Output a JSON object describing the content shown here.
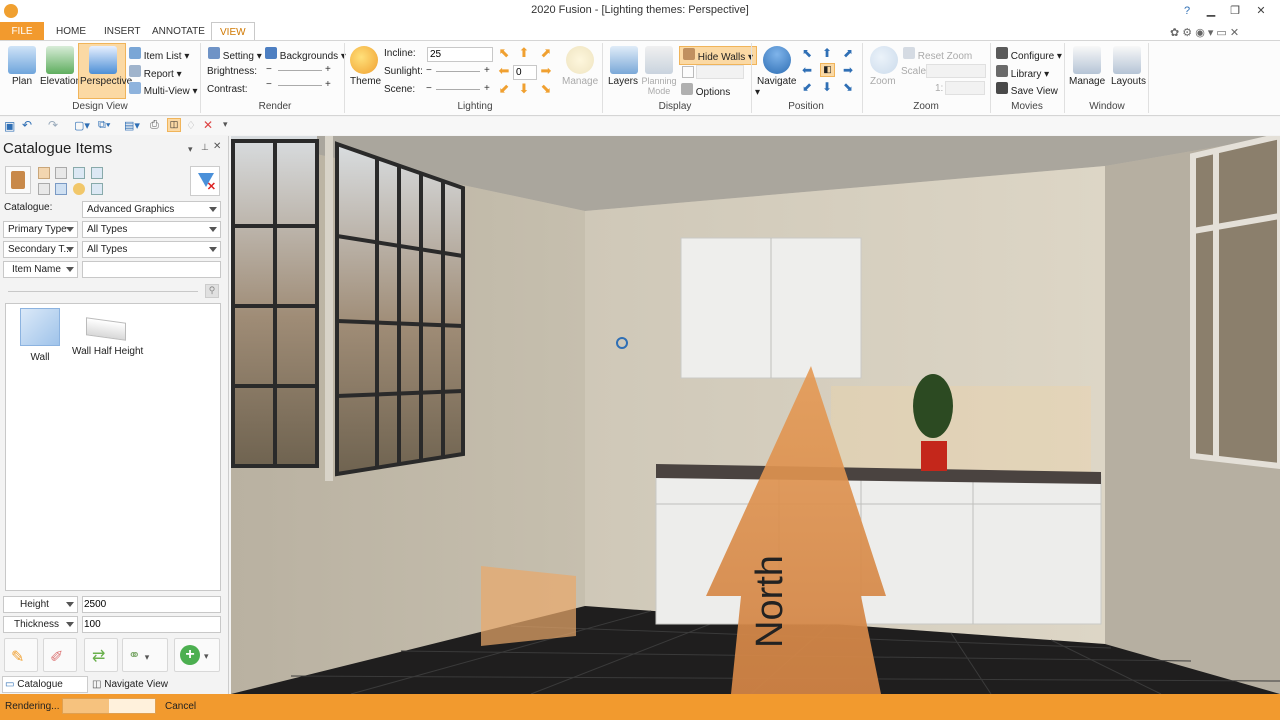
{
  "window": {
    "title": "2020 Fusion - [Lighting themes: Perspective]"
  },
  "tabs": [
    "FILE",
    "HOME",
    "INSERT",
    "ANNOTATE",
    "VIEW"
  ],
  "ribbon": {
    "design_view": {
      "label": "Design View",
      "plan": "Plan",
      "elevation": "Elevation",
      "perspective": "Perspective",
      "item_list": "Item List",
      "report": "Report",
      "multi_view": "Multi-View"
    },
    "render": {
      "label": "Render",
      "setting": "Setting",
      "backgrounds": "Backgrounds",
      "brightness": "Brightness:",
      "contrast": "Contrast:"
    },
    "lighting": {
      "label": "Lighting",
      "theme": "Theme",
      "incline_label": "Incline:",
      "incline_value": "25",
      "sunlight_label": "Sunlight:",
      "sunlight_value": "0",
      "scene_label": "Scene:",
      "manage": "Manage"
    },
    "display": {
      "label": "Display",
      "layers": "Layers",
      "planning_mode": "Planning Mode",
      "hide_walls": "Hide Walls",
      "options": "Options"
    },
    "position": {
      "label": "Position",
      "navigate": "Navigate"
    },
    "zoom": {
      "label": "Zoom",
      "zoom": "Zoom",
      "reset_zoom": "Reset Zoom",
      "scale": "Scale:",
      "scale_ratio": "1:"
    },
    "movies": {
      "label": "Movies",
      "configure": "Configure",
      "library": "Library",
      "save_view": "Save View"
    },
    "window": {
      "label": "Window",
      "manage": "Manage",
      "layouts": "Layouts"
    }
  },
  "panel": {
    "title": "Catalogue Items",
    "catalogue_label": "Catalogue:",
    "catalogue_value": "Advanced Graphics",
    "primary_type_label": "Primary Type",
    "primary_type_value": "All Types",
    "secondary_type_label": "Secondary T...",
    "secondary_type_value": "All Types",
    "item_name_label": "Item Name",
    "item_name_value": "",
    "items": [
      {
        "label": "Wall"
      },
      {
        "label": "Wall Half Height"
      }
    ],
    "height_label": "Height",
    "height_value": "2500",
    "thickness_label": "Thickness",
    "thickness_value": "100",
    "bottom_tabs": [
      "Catalogue Items",
      "Navigate View"
    ]
  },
  "viewport": {
    "compass_label": "North"
  },
  "status": {
    "text": "Rendering...",
    "progress": 0.5,
    "cancel": "Cancel"
  },
  "colors": {
    "accent": "#f29a2e",
    "ribbon_blue": "#2f6fb5"
  }
}
